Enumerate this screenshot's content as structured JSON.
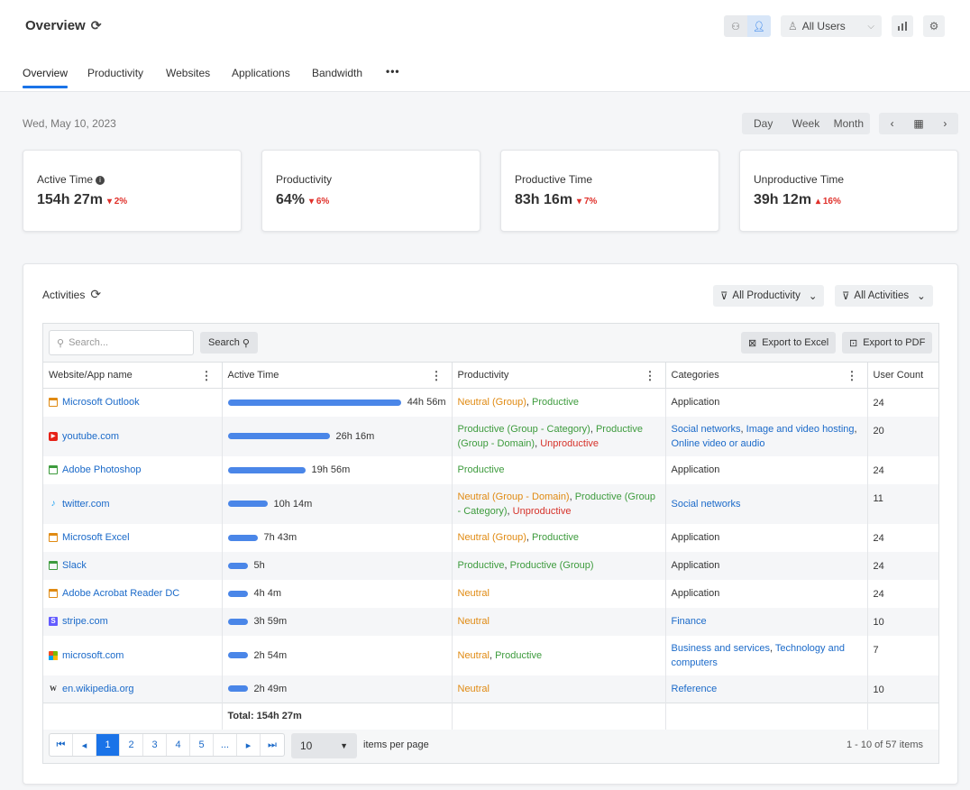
{
  "header": {
    "title": "Overview",
    "user_filter": "All Users"
  },
  "tabs": [
    {
      "label": "Overview"
    },
    {
      "label": "Productivity"
    },
    {
      "label": "Websites"
    },
    {
      "label": "Applications"
    },
    {
      "label": "Bandwidth"
    },
    {
      "label": "•••"
    }
  ],
  "date": "Wed, May 10, 2023",
  "range": {
    "day": "Day",
    "week": "Week",
    "month": "Month"
  },
  "cards": [
    {
      "label": "Active Time",
      "value": "154h 27m",
      "delta": "2%",
      "direction": "down"
    },
    {
      "label": "Productivity",
      "value": "64%",
      "delta": "6%",
      "direction": "down"
    },
    {
      "label": "Productive Time",
      "value": "83h 16m",
      "delta": "7%",
      "direction": "down"
    },
    {
      "label": "Unproductive Time",
      "value": "39h 12m",
      "delta": "16%",
      "direction": "up"
    }
  ],
  "activities": {
    "title": "Activities",
    "filter_productivity": "All Productivity",
    "filter_activities": "All Activities",
    "search_placeholder": "Search...",
    "search_button": "Search",
    "export_excel": "Export to Excel",
    "export_pdf": "Export to PDF",
    "columns": [
      "Website/App name",
      "Active Time",
      "Productivity",
      "Categories",
      "User Count"
    ],
    "rows": [
      {
        "name": "Microsoft Outlook",
        "icon": "app-window-icon",
        "icon_color": "#e08a12",
        "time": "44h 56m",
        "fraction": 1.0,
        "productivity": [
          {
            "text": "Neutral (Group)",
            "kind": "neutral"
          },
          {
            "text": "Productive",
            "kind": "productive"
          }
        ],
        "categories": [
          {
            "text": "Application",
            "link": false
          }
        ],
        "count": "24"
      },
      {
        "name": "youtube.com",
        "icon": "youtube-icon",
        "icon_color": "#e62117",
        "time": "26h 16m",
        "fraction": 0.585,
        "productivity": [
          {
            "text": "Productive (Group - Category)",
            "kind": "productive"
          },
          {
            "text": "Productive (Group - Domain)",
            "kind": "productive"
          },
          {
            "text": "Unproductive",
            "kind": "unproductive"
          }
        ],
        "categories": [
          {
            "text": "Social networks",
            "link": true
          },
          {
            "text": "Image and video hosting",
            "link": true
          },
          {
            "text": "Online video or audio",
            "link": true
          }
        ],
        "count": "20"
      },
      {
        "name": "Adobe Photoshop",
        "icon": "app-window-icon",
        "icon_color": "#3d9b3d",
        "time": "19h 56m",
        "fraction": 0.444,
        "productivity": [
          {
            "text": "Productive",
            "kind": "productive"
          }
        ],
        "categories": [
          {
            "text": "Application",
            "link": false
          }
        ],
        "count": "24"
      },
      {
        "name": "twitter.com",
        "icon": "twitter-icon",
        "icon_color": "#1da1f2",
        "time": "10h 14m",
        "fraction": 0.228,
        "productivity": [
          {
            "text": "Neutral (Group - Domain)",
            "kind": "neutral"
          },
          {
            "text": "Productive (Group - Category)",
            "kind": "productive"
          },
          {
            "text": "Unproductive",
            "kind": "unproductive"
          }
        ],
        "categories": [
          {
            "text": "Social networks",
            "link": true
          }
        ],
        "count": "11"
      },
      {
        "name": "Microsoft Excel",
        "icon": "app-window-icon",
        "icon_color": "#e08a12",
        "time": "7h 43m",
        "fraction": 0.172,
        "productivity": [
          {
            "text": "Neutral (Group)",
            "kind": "neutral"
          },
          {
            "text": "Productive",
            "kind": "productive"
          }
        ],
        "categories": [
          {
            "text": "Application",
            "link": false
          }
        ],
        "count": "24"
      },
      {
        "name": "Slack",
        "icon": "app-window-icon",
        "icon_color": "#3d9b3d",
        "time": "5h",
        "fraction": 0.111,
        "productivity": [
          {
            "text": "Productive",
            "kind": "productive"
          },
          {
            "text": "Productive (Group)",
            "kind": "productive"
          }
        ],
        "categories": [
          {
            "text": "Application",
            "link": false
          }
        ],
        "count": "24"
      },
      {
        "name": "Adobe Acrobat Reader DC",
        "icon": "app-window-icon",
        "icon_color": "#e08a12",
        "time": "4h 4m",
        "fraction": 0.09,
        "productivity": [
          {
            "text": "Neutral",
            "kind": "neutral"
          }
        ],
        "categories": [
          {
            "text": "Application",
            "link": false
          }
        ],
        "count": "24"
      },
      {
        "name": "stripe.com",
        "icon": "stripe-icon",
        "icon_color": "#635bff",
        "time": "3h 59m",
        "fraction": 0.088,
        "productivity": [
          {
            "text": "Neutral",
            "kind": "neutral"
          }
        ],
        "categories": [
          {
            "text": "Finance",
            "link": true
          }
        ],
        "count": "10"
      },
      {
        "name": "microsoft.com",
        "icon": "microsoft-icon",
        "icon_color": "#f25022",
        "time": "2h 54m",
        "fraction": 0.065,
        "productivity": [
          {
            "text": "Neutral",
            "kind": "neutral"
          },
          {
            "text": "Productive",
            "kind": "productive"
          }
        ],
        "categories": [
          {
            "text": "Business and services",
            "link": true
          },
          {
            "text": "Technology and computers",
            "link": true
          }
        ],
        "count": "7"
      },
      {
        "name": "en.wikipedia.org",
        "icon": "wikipedia-icon",
        "icon_color": "#333333",
        "time": "2h 49m",
        "fraction": 0.063,
        "productivity": [
          {
            "text": "Neutral",
            "kind": "neutral"
          }
        ],
        "categories": [
          {
            "text": "Reference",
            "link": true
          }
        ],
        "count": "10"
      }
    ],
    "total": "Total: 154h 27m",
    "pager": {
      "pages": [
        "1",
        "2",
        "3",
        "4",
        "5",
        "..."
      ],
      "current": "1",
      "page_size": "10",
      "items_per_page_label": "items per page",
      "range_info": "1 - 10 of 57 items"
    }
  }
}
